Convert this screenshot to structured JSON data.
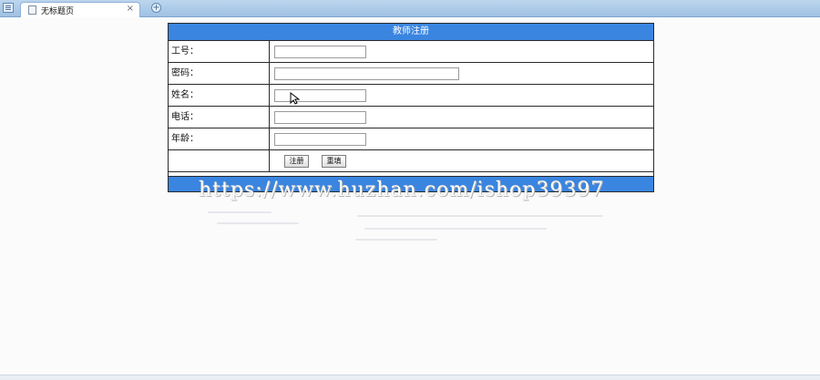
{
  "browser": {
    "tab_title": "无标题页",
    "tab_close": "×",
    "new_tab_symbol": "+"
  },
  "form": {
    "title": "教师注册",
    "fields": [
      {
        "label": "工号：",
        "value": ""
      },
      {
        "label": "密码：",
        "value": ""
      },
      {
        "label": "姓名：",
        "value": ""
      },
      {
        "label": "电话：",
        "value": ""
      },
      {
        "label": "年龄：",
        "value": ""
      }
    ],
    "register_button": "注册",
    "reset_button": "重填"
  },
  "watermark": "https://www.huzhan.com/ishop39397",
  "colors": {
    "header_blue": "#3a85e0",
    "tabbar_blue": "#a9c8e8"
  }
}
